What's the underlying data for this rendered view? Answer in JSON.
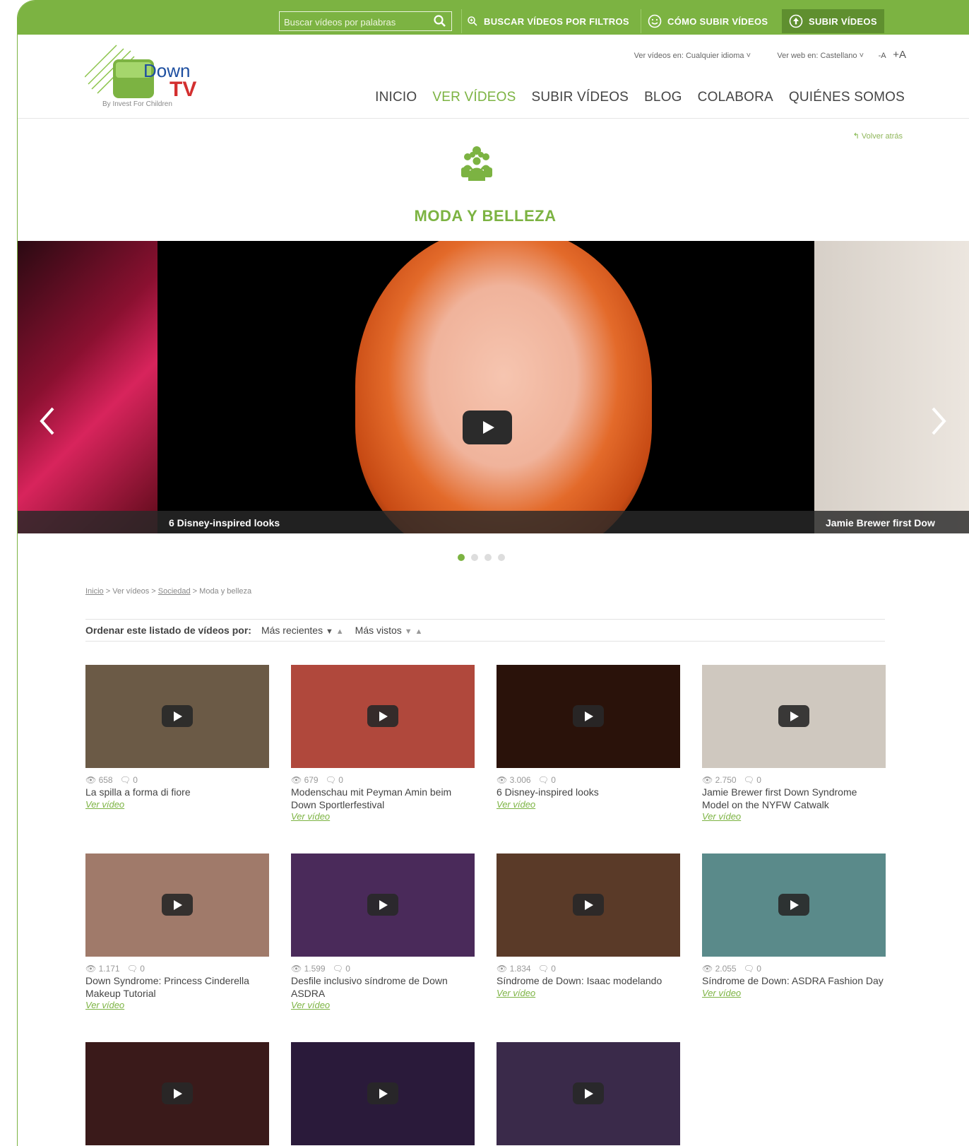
{
  "topbar": {
    "search_placeholder": "Buscar vídeos por palabras",
    "filters_label": "BUSCAR VÍDEOS POR FILTROS",
    "how_label": "CÓMO SUBIR VÍDEOS",
    "upload_label": "SUBIR VÍDEOS"
  },
  "header": {
    "logo_text_down": "Down",
    "logo_text_tv": "TV",
    "logo_sub": "By Invest For Children",
    "videos_lang": "Ver vídeos en: Cualquier idioma ˅",
    "web_lang": "Ver web en: Castellano ˅",
    "font_smaller": "-A",
    "font_bigger": "+A",
    "nav": [
      "INICIO",
      "VER VÍDEOS",
      "SUBIR VÍDEOS",
      "BLOG",
      "COLABORA",
      "QUIÉNES SOMOS"
    ]
  },
  "back_label": "Volver atrás",
  "category_title": "MODA Y BELLEZA",
  "carousel": {
    "main_caption": "6 Disney-inspired looks",
    "right_caption": "Jamie Brewer first Dow",
    "slides": 4,
    "active_index": 0
  },
  "breadcrumb": {
    "home": "Inicio",
    "sep1": " > Ver vídeos > ",
    "society": "Sociedad",
    "sep2": " > Moda y belleza"
  },
  "sort": {
    "label": "Ordenar este listado de vídeos por:",
    "recent": "Más recientes",
    "views": "Más vistos"
  },
  "videos": [
    {
      "views": "658",
      "comments": "0",
      "title": "La spilla a forma di fiore",
      "link": "Ver vídeo",
      "color": "#6b5a46"
    },
    {
      "views": "679",
      "comments": "0",
      "title": "Modenschau mit Peyman Amin beim Down Sportlerfestival",
      "link": "Ver vídeo",
      "color": "#b0483c"
    },
    {
      "views": "3.006",
      "comments": "0",
      "title": "6 Disney-inspired looks",
      "link": "Ver vídeo",
      "color": "#2a120a"
    },
    {
      "views": "2.750",
      "comments": "0",
      "title": "Jamie Brewer first Down Syndrome Model on the NYFW Catwalk",
      "link": "Ver vídeo",
      "color": "#cfc8bf"
    },
    {
      "views": "1.171",
      "comments": "0",
      "title": "Down Syndrome: Princess Cinderella Makeup Tutorial",
      "link": "Ver vídeo",
      "color": "#a07a6a"
    },
    {
      "views": "1.599",
      "comments": "0",
      "title": "Desfile inclusivo síndrome de Down ASDRA",
      "link": "Ver vídeo",
      "color": "#4a2a5a"
    },
    {
      "views": "1.834",
      "comments": "0",
      "title": "Síndrome de Down: Isaac modelando",
      "link": "Ver vídeo",
      "color": "#5a3a28"
    },
    {
      "views": "2.055",
      "comments": "0",
      "title": "Síndrome de Down: ASDRA Fashion Day",
      "link": "Ver vídeo",
      "color": "#5a8a8a"
    },
    {
      "views": "",
      "comments": "",
      "title": "",
      "link": "",
      "color": "#3a1a1a"
    },
    {
      "views": "",
      "comments": "",
      "title": "",
      "link": "",
      "color": "#2a1a3a"
    },
    {
      "views": "",
      "comments": "",
      "title": "",
      "link": "",
      "color": "#3a2a4a"
    }
  ]
}
